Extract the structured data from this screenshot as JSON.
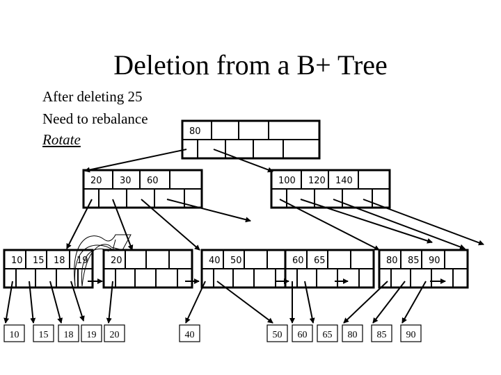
{
  "title": "Deletion from a B+ Tree",
  "notes": {
    "line1": "After deleting 25",
    "line2": "Need to rebalance",
    "line3": "Rotate"
  },
  "tree": {
    "root": {
      "keys": [
        "80",
        "",
        "",
        ""
      ]
    },
    "internal": [
      {
        "keys": [
          "20",
          "30",
          "60",
          ""
        ]
      },
      {
        "keys": [
          "100",
          "120",
          "140",
          ""
        ]
      }
    ],
    "leaves": [
      {
        "keys": [
          "10",
          "15",
          "18",
          "19"
        ]
      },
      {
        "keys": [
          "20",
          "",
          "",
          ""
        ]
      },
      {
        "keys": [
          "40",
          "50",
          "",
          ""
        ]
      },
      {
        "keys": [
          "60",
          "65",
          "",
          ""
        ]
      },
      {
        "keys": [
          "80",
          "85",
          "90",
          ""
        ]
      }
    ],
    "records": [
      "10",
      "15",
      "18",
      "19",
      "20",
      "40",
      "50",
      "60",
      "65",
      "80",
      "85",
      "90"
    ]
  },
  "colors": {
    "stroke": "#000000",
    "background": "#ffffff"
  }
}
